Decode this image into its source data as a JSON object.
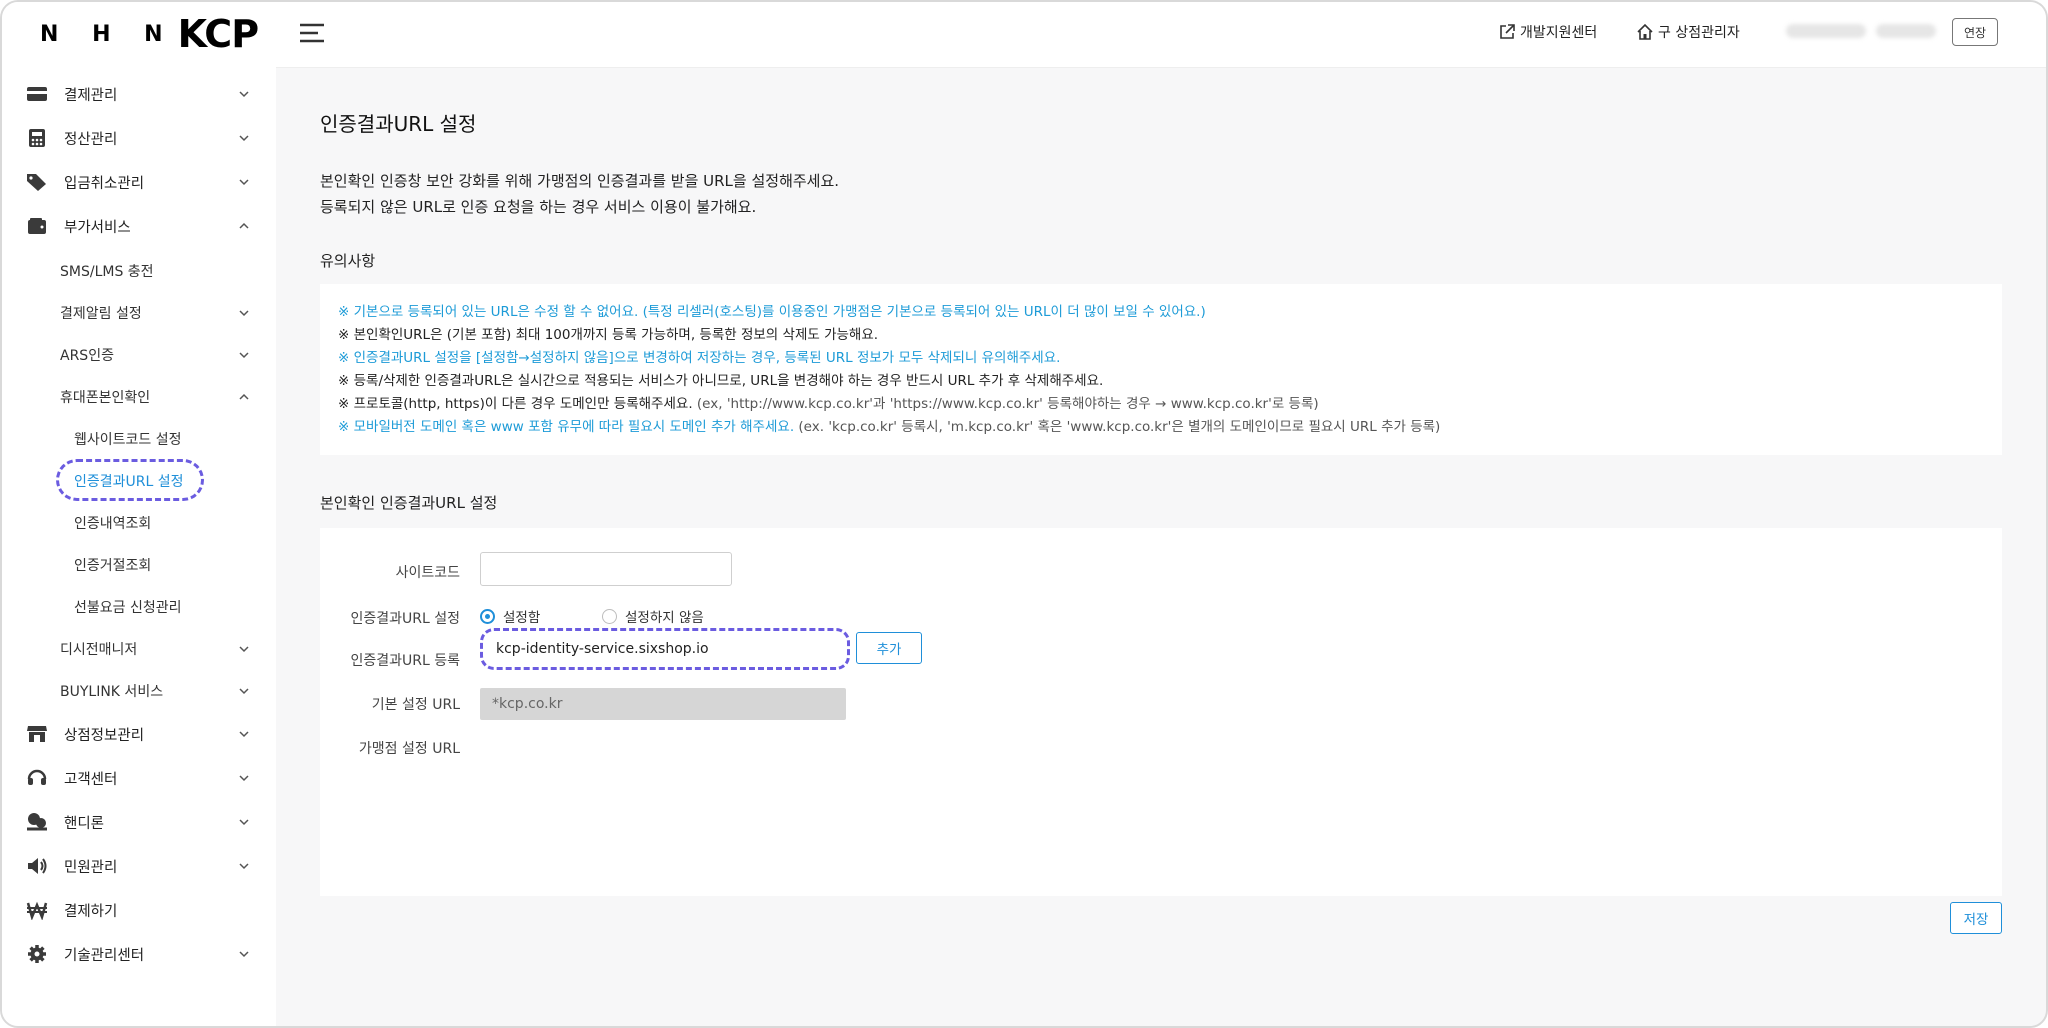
{
  "brand": {
    "nhn": "N H N",
    "kcp": "KCP"
  },
  "sidebar": {
    "menu": [
      {
        "label": "결제관리"
      },
      {
        "label": "정산관리"
      },
      {
        "label": "입금취소관리"
      },
      {
        "label": "부가서비스"
      },
      {
        "label": "상점정보관리"
      },
      {
        "label": "고객센터"
      },
      {
        "label": "핸디론"
      },
      {
        "label": "민원관리"
      },
      {
        "label": "결제하기"
      },
      {
        "label": "기술관리센터"
      }
    ],
    "sub": [
      {
        "label": "SMS/LMS 충전"
      },
      {
        "label": "결제알림 설정"
      },
      {
        "label": "ARS인증"
      },
      {
        "label": "휴대폰본인확인"
      },
      {
        "label": "웹사이트코드 설정"
      },
      {
        "label": "인증결과URL 설정"
      },
      {
        "label": "인증내역조회"
      },
      {
        "label": "인증거절조회"
      },
      {
        "label": "선불요금 신청관리"
      },
      {
        "label": "디시전매니저"
      },
      {
        "label": "BUYLINK 서비스"
      }
    ]
  },
  "topbar": {
    "dev_center": "개발지원센터",
    "old_admin": "구 상점관리자",
    "extend": "연장"
  },
  "page": {
    "title": "인증결과URL 설정",
    "intro_1": "본인확인 인증창 보안 강화를 위해 가맹점의 인증결과를 받을 URL을 설정해주세요.",
    "intro_2": "등록되지 않은 URL로 인증 요청을 하는 경우 서비스 이용이 불가해요.",
    "notice_title": "유의사항",
    "notices": {
      "n1": "※ 기본으로 등록되어 있는 URL은 수정 할 수 없어요. (특정 리셀러(호스팅)를 이용중인 가맹점은 기본으로 등록되어 있는 URL이 더 많이 보일 수 있어요.)",
      "n2": "※ 본인확인URL은 (기본 포함) 최대 100개까지 등록 가능하며, 등록한 정보의 삭제도 가능해요.",
      "n3": "※ 인증결과URL 설정을 [설정함→설정하지 않음]으로 변경하여 저장하는 경우, 등록된 URL 정보가 모두 삭제되니 유의해주세요.",
      "n4": "※ 등록/삭제한 인증결과URL은 실시간으로 적용되는 서비스가 아니므로, URL을 변경해야 하는 경우 반드시 URL 추가 후 삭제해주세요.",
      "n5a": "※ 프로토콜(http, https)이 다른 경우 도메인만 등록해주세요.",
      "n5b": " (ex, 'http://www.kcp.co.kr'과 'https://www.kcp.co.kr' 등록해야하는 경우 → www.kcp.co.kr'로 등록)",
      "n6a": "※ 모바일버전 도메인 혹은 www 포함 유무에 따라 필요시 도메인 추가 해주세요.",
      "n6b": " (ex. 'kcp.co.kr' 등록시, 'm.kcp.co.kr' 혹은 'www.kcp.co.kr'은 별개의 도메인이므로 필요시 URL 추가 등록)"
    },
    "form_title": "본인확인 인증결과URL 설정",
    "form": {
      "site_code_label": "사이트코드",
      "site_code_value": "",
      "url_setting_label": "인증결과URL 설정",
      "radio_on": "설정함",
      "radio_off": "설정하지 않음",
      "url_register_label": "인증결과URL 등록",
      "url_register_value": "kcp-identity-service.sixshop.io",
      "add_button": "추가",
      "default_url_label": "기본 설정 URL",
      "default_url_value": "*kcp.co.kr",
      "merchant_url_label": "가맹점 설정 URL"
    },
    "save_button": "저장"
  },
  "colors": {
    "accent": "#1f8fd9",
    "notice_blue": "#1d9bd7",
    "highlight": "#6b5ce0"
  }
}
